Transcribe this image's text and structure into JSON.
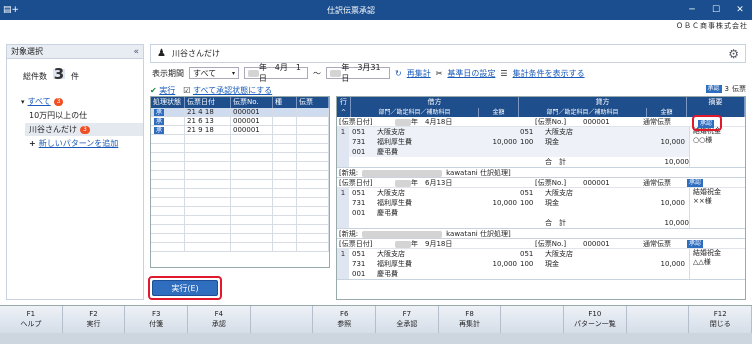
{
  "window": {
    "title": "仕訳伝票承認",
    "company": "ＯＢＣ商事株式会社"
  },
  "left_pane": {
    "header": "対象選択",
    "total_label": "総件数",
    "total_count": "3",
    "total_unit": "件",
    "tree": [
      {
        "label": "すべて",
        "badge": "3"
      },
      {
        "label": "10万円以上の仕"
      },
      {
        "label": "川谷さんだけ",
        "badge": "3"
      }
    ],
    "add_pattern_label": "新しいパターンを追加"
  },
  "top": {
    "pattern_name": "川谷さんだけ",
    "icon": "user-stamp-icon",
    "gear_icon": "gear-icon"
  },
  "filters": {
    "period_label": "表示期間",
    "period_select": "すべて",
    "date_from": "年　4月　1日",
    "date_to": "年　3月31日",
    "recalc": "再集計",
    "base_date": "基準日の設定",
    "show_conditions": "集計条件を表示する"
  },
  "actions": {
    "execute": "実行",
    "set_all": "すべて承認状態にする"
  },
  "grid": {
    "headers": [
      "処理状態",
      "伝票日付",
      "伝票No.",
      "種",
      "伝票"
    ],
    "rows": [
      {
        "status": "承",
        "year": "21",
        "month": "4",
        "day": "18",
        "no": "000001"
      },
      {
        "status": "承",
        "year": "21",
        "month": "6",
        "day": "13",
        "no": "000001"
      },
      {
        "status": "承",
        "year": "21",
        "month": "9",
        "day": "18",
        "no": "000001"
      }
    ]
  },
  "execute_button": "実行(E)",
  "right": {
    "approval_label": "承認",
    "approval_count": "3",
    "approval_unit": "伝票",
    "headers": {
      "row": "行",
      "debit": "借方",
      "credit": "貸方",
      "summary": "摘要",
      "dept": "部門／勘定科目／補助科目",
      "amount": "金額"
    },
    "vouchers": [
      {
        "date_label": "[伝票日付]",
        "date": "年　4月18日",
        "no_label": "[伝票No.]",
        "no": "000001",
        "type": "通常伝票",
        "status": "承認",
        "debit_codes": [
          "051",
          "731",
          "001"
        ],
        "debit_names": [
          "大阪支店",
          "福利厚生費",
          "慶弔費"
        ],
        "debit_amount": "10,000",
        "credit_codes": [
          "051",
          "100"
        ],
        "credit_names": [
          "大阪支店",
          "現金"
        ],
        "credit_amount": "10,000",
        "summary": [
          "結婚祝金",
          "○○様"
        ],
        "total_label": "合　計",
        "total_debit": "10,000",
        "total_credit": "10,000",
        "new_label": "[新規:",
        "new_user": "kawatani 仕訳処理]"
      },
      {
        "date_label": "[伝票日付]",
        "date": "年　6月13日",
        "no_label": "[伝票No.]",
        "no": "000001",
        "type": "通常伝票",
        "status": "承認",
        "debit_codes": [
          "051",
          "731",
          "001"
        ],
        "debit_names": [
          "大阪支店",
          "福利厚生費",
          "慶弔費"
        ],
        "debit_amount": "10,000",
        "credit_codes": [
          "051",
          "100"
        ],
        "credit_names": [
          "大阪支店",
          "現金"
        ],
        "credit_amount": "10,000",
        "summary": [
          "結婚祝金",
          "××様"
        ],
        "total_label": "合　計",
        "total_debit": "10,000",
        "total_credit": "10,000",
        "new_label": "[新規:",
        "new_user": "kawatani 仕訳処理]"
      },
      {
        "date_label": "[伝票日付]",
        "date": "年　9月18日",
        "no_label": "[伝票No.]",
        "no": "000001",
        "type": "通常伝票",
        "status": "承認",
        "debit_codes": [
          "051",
          "731",
          "001"
        ],
        "debit_names": [
          "大阪支店",
          "福利厚生費",
          "慶弔費"
        ],
        "debit_amount": "10,000",
        "credit_codes": [
          "051",
          "100"
        ],
        "credit_names": [
          "大阪支店",
          "現金"
        ],
        "credit_amount": "10,000",
        "summary": [
          "結婚祝金",
          "△△様"
        ]
      }
    ]
  },
  "fkeys": [
    {
      "key": "F1",
      "label": "ヘルプ"
    },
    {
      "key": "F2",
      "label": "実行"
    },
    {
      "key": "F3",
      "label": "付箋"
    },
    {
      "key": "F4",
      "label": "承認"
    },
    {
      "key": "",
      "label": ""
    },
    {
      "key": "F6",
      "label": "参照"
    },
    {
      "key": "F7",
      "label": "全承認"
    },
    {
      "key": "F8",
      "label": "再集計"
    },
    {
      "key": "",
      "label": ""
    },
    {
      "key": "F10",
      "label": "パターン一覧"
    },
    {
      "key": "",
      "label": ""
    },
    {
      "key": "F12",
      "label": "閉じる"
    }
  ]
}
